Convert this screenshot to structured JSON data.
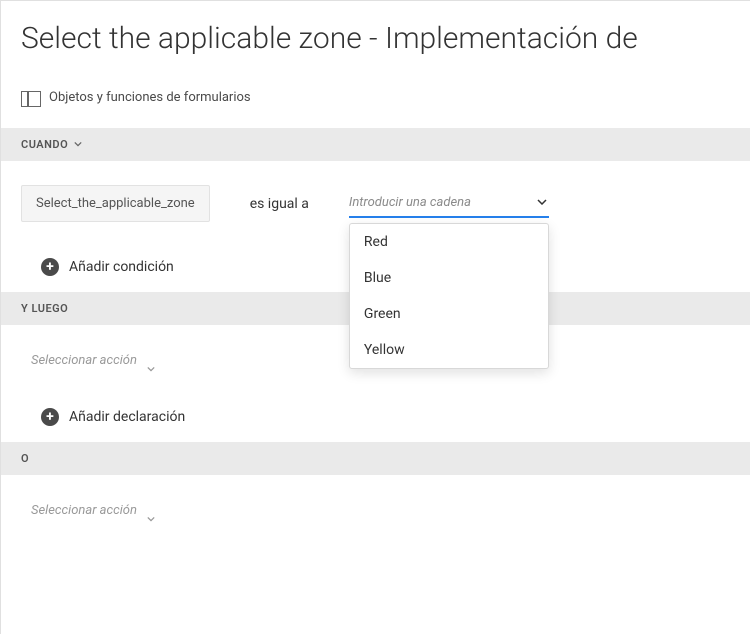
{
  "title": "Select the applicable zone - Implementación de",
  "toolbar": {
    "form_objects_label": "Objetos y funciones de formularios"
  },
  "sections": {
    "cuando": "CUANDO",
    "y_luego": "Y LUEGO",
    "o": "O"
  },
  "condition": {
    "field_name": "Select_the_applicable_zone",
    "operator": "es igual a",
    "value_placeholder": "Introducir una cadena",
    "options": [
      "Red",
      "Blue",
      "Green",
      "Yellow"
    ]
  },
  "actions": {
    "add_condition": "Añadir condición",
    "add_declaration": "Añadir declaración",
    "select_action": "Seleccionar acción"
  }
}
